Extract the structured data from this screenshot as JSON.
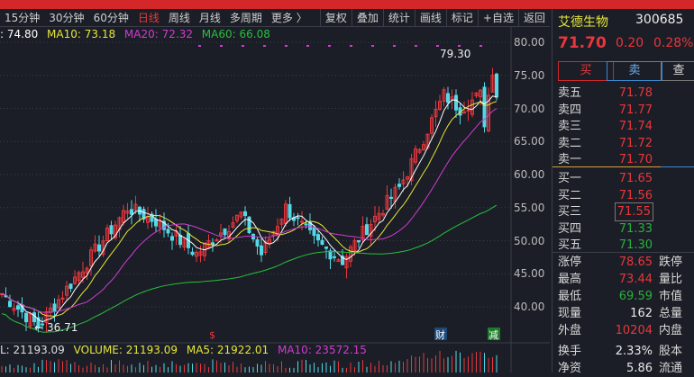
{
  "toolbar": {
    "tabs": [
      "15分钟",
      "30分钟",
      "60分钟",
      "日线",
      "周线",
      "月线",
      "多周期",
      "更多 〉"
    ],
    "active": "日线",
    "tools": [
      "复权",
      "叠加",
      "统计",
      "画线",
      "标记",
      "+自选",
      "返回"
    ]
  },
  "ma_legend": {
    "ma5": ": 74.80",
    "ma10": "MA10: 73.18",
    "ma20": "MA20: 72.32",
    "ma60": "MA60: 66.08"
  },
  "axis": [
    "80.00",
    "75.00",
    "70.00",
    "65.00",
    "60.00",
    "55.00",
    "50.00",
    "45.00",
    "40.00"
  ],
  "annotations": {
    "high": "79.30",
    "low": "36.71",
    "markers": [
      "$",
      "财",
      "减"
    ]
  },
  "volume_legend": {
    "vol": "L: 21193.09",
    "volume": "VOLUME: 21193.09",
    "ma5": "MA5: 21922.01",
    "ma10": "MA10: 23572.15"
  },
  "stock": {
    "name": "艾德生物",
    "code": "300685",
    "price": "71.70",
    "change": "0.20",
    "pct": "0.28%",
    "buy": "买",
    "sell": "卖",
    "query": "查"
  },
  "orderbook": [
    {
      "l": "卖五",
      "v": "71.78",
      "c": "red"
    },
    {
      "l": "卖四",
      "v": "71.77",
      "c": "red"
    },
    {
      "l": "卖三",
      "v": "71.74",
      "c": "red"
    },
    {
      "l": "卖二",
      "v": "71.72",
      "c": "red"
    },
    {
      "l": "卖一",
      "v": "71.70",
      "c": "red"
    },
    {
      "l": "买一",
      "v": "71.65",
      "c": "red"
    },
    {
      "l": "买二",
      "v": "71.56",
      "c": "red"
    },
    {
      "l": "买三",
      "v": "71.55",
      "c": "red"
    },
    {
      "l": "买四",
      "v": "71.33",
      "c": "green"
    },
    {
      "l": "买五",
      "v": "71.30",
      "c": "green"
    }
  ],
  "stats": [
    {
      "l": "涨停",
      "v": "78.65",
      "c": "red",
      "r": "跌停"
    },
    {
      "l": "最高",
      "v": "73.44",
      "c": "red",
      "r": "量比"
    },
    {
      "l": "最低",
      "v": "69.59",
      "c": "green",
      "r": "市值"
    },
    {
      "l": "现量",
      "v": "162",
      "c": "white",
      "r": "总量"
    },
    {
      "l": "外盘",
      "v": "10204",
      "c": "red",
      "r": "内盘"
    },
    {
      "l": "换手",
      "v": "2.33%",
      "c": "white",
      "r": "股本"
    },
    {
      "l": "净资",
      "v": "5.86",
      "c": "white",
      "r": "流通"
    }
  ],
  "colors": {
    "up": "#e8373c",
    "down": "#54d8e8",
    "ma5": "#ffffff",
    "ma10": "#e6e63c",
    "ma20": "#d03cd0",
    "ma60": "#27c13d"
  },
  "chart_data": {
    "type": "candlestick",
    "ylim": [
      37,
      81
    ],
    "keypoints": [
      [
        0,
        42
      ],
      [
        9,
        37
      ],
      [
        20,
        46
      ],
      [
        31,
        55
      ],
      [
        38,
        53
      ],
      [
        48,
        48
      ],
      [
        59,
        54
      ],
      [
        64,
        48
      ],
      [
        70,
        55
      ],
      [
        77,
        50
      ],
      [
        84,
        47
      ],
      [
        90,
        52
      ],
      [
        98,
        58
      ],
      [
        102,
        63
      ],
      [
        109,
        72
      ],
      [
        113,
        70
      ],
      [
        118,
        72
      ],
      [
        119,
        68
      ],
      [
        121,
        76
      ],
      [
        122,
        71.7
      ]
    ]
  }
}
